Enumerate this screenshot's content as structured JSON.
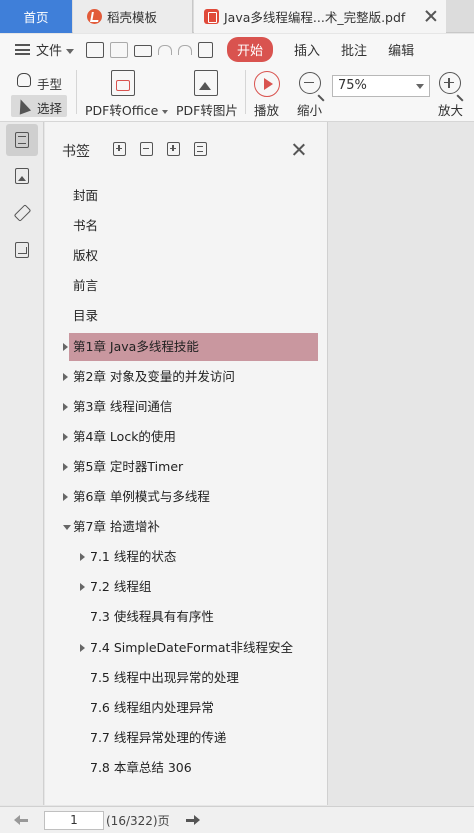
{
  "tabs": {
    "home": "首页",
    "daoke": "稻壳模板",
    "document": "Java多线程编程...术_完整版.pdf"
  },
  "menu": {
    "file": "文件",
    "start": "开始",
    "insert": "插入",
    "annotate": "批注",
    "edit": "编辑"
  },
  "ribbon": {
    "hand": "手型",
    "select": "选择",
    "pdf_to_office": "PDF转Office",
    "pdf_to_image": "PDF转图片",
    "play": "播放",
    "zoom_out": "缩小",
    "zoom_value": "75%",
    "zoom_in": "放大"
  },
  "bookmarks": {
    "title": "书签",
    "items": [
      {
        "label": "封面",
        "level": 0,
        "arrow": "none"
      },
      {
        "label": "书名",
        "level": 0,
        "arrow": "none"
      },
      {
        "label": "版权",
        "level": 0,
        "arrow": "none"
      },
      {
        "label": "前言",
        "level": 0,
        "arrow": "none"
      },
      {
        "label": "目录",
        "level": 0,
        "arrow": "none"
      },
      {
        "label": "第1章 Java多线程技能",
        "level": 0,
        "arrow": "right",
        "selected": true
      },
      {
        "label": "第2章 对象及变量的并发访问",
        "level": 0,
        "arrow": "right"
      },
      {
        "label": "第3章 线程间通信",
        "level": 0,
        "arrow": "right"
      },
      {
        "label": "第4章 Lock的使用",
        "level": 0,
        "arrow": "right"
      },
      {
        "label": "第5章 定时器Timer",
        "level": 0,
        "arrow": "right"
      },
      {
        "label": "第6章 单例模式与多线程",
        "level": 0,
        "arrow": "right"
      },
      {
        "label": "第7章 拾遗增补",
        "level": 0,
        "arrow": "down"
      },
      {
        "label": "7.1 线程的状态",
        "level": 1,
        "arrow": "right"
      },
      {
        "label": "7.2 线程组",
        "level": 1,
        "arrow": "right"
      },
      {
        "label": "7.3 使线程具有有序性",
        "level": 1,
        "arrow": "none"
      },
      {
        "label": "7.4 SimpleDateFormat非线程安全",
        "level": 1,
        "arrow": "right"
      },
      {
        "label": "7.5 线程中出现异常的处理",
        "level": 1,
        "arrow": "none"
      },
      {
        "label": "7.6 线程组内处理异常",
        "level": 1,
        "arrow": "none"
      },
      {
        "label": "7.7 线程异常处理的传递",
        "level": 1,
        "arrow": "none"
      },
      {
        "label": "7.8 本章总结 306",
        "level": 1,
        "arrow": "none"
      }
    ]
  },
  "pager": {
    "current": "1",
    "info": "(16/322)页"
  }
}
